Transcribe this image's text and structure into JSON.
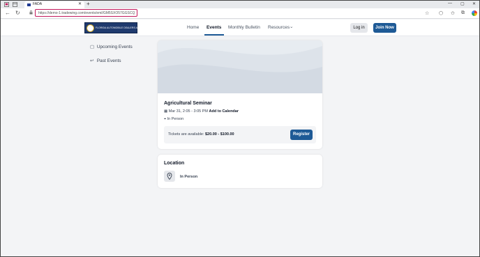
{
  "browser": {
    "tab_title": "FADA",
    "tab_close": "✕",
    "new_tab": "+",
    "url": "https://demo-1.tradewing.com/events/eml/GM5SXO57GGSCQ",
    "window_controls": [
      "—",
      "▢",
      "✕"
    ]
  },
  "header": {
    "logo_text": "FLORIDA AUTOMOBILE DEALERS ASSOCIATION",
    "nav": [
      "Home",
      "Events",
      "Monthly Bulletin",
      "Resources"
    ],
    "active_nav": "Events",
    "resources_chevron": "⌄",
    "login_label": "Log in",
    "join_label": "Join Now"
  },
  "sidebar": {
    "items": [
      {
        "label": "Upcoming Events",
        "icon": "calendar-icon"
      },
      {
        "label": "Past Events",
        "icon": "return-arrow-icon"
      }
    ]
  },
  "event": {
    "title": "Agricultural Seminar",
    "date": "Mar 31, 2:05 - 3:05 PM",
    "add_to_calendar": "Add to Calendar",
    "mode": "In Person",
    "tickets_prefix": "Tickets are available:",
    "tickets_price": "$20.00 - $100.00",
    "register_label": "Register"
  },
  "location": {
    "title": "Location",
    "value": "In Person"
  },
  "colors": {
    "brand": "#1e5a96",
    "url_highlight": "#c2185b",
    "page_bg": "#f3f4f6"
  }
}
